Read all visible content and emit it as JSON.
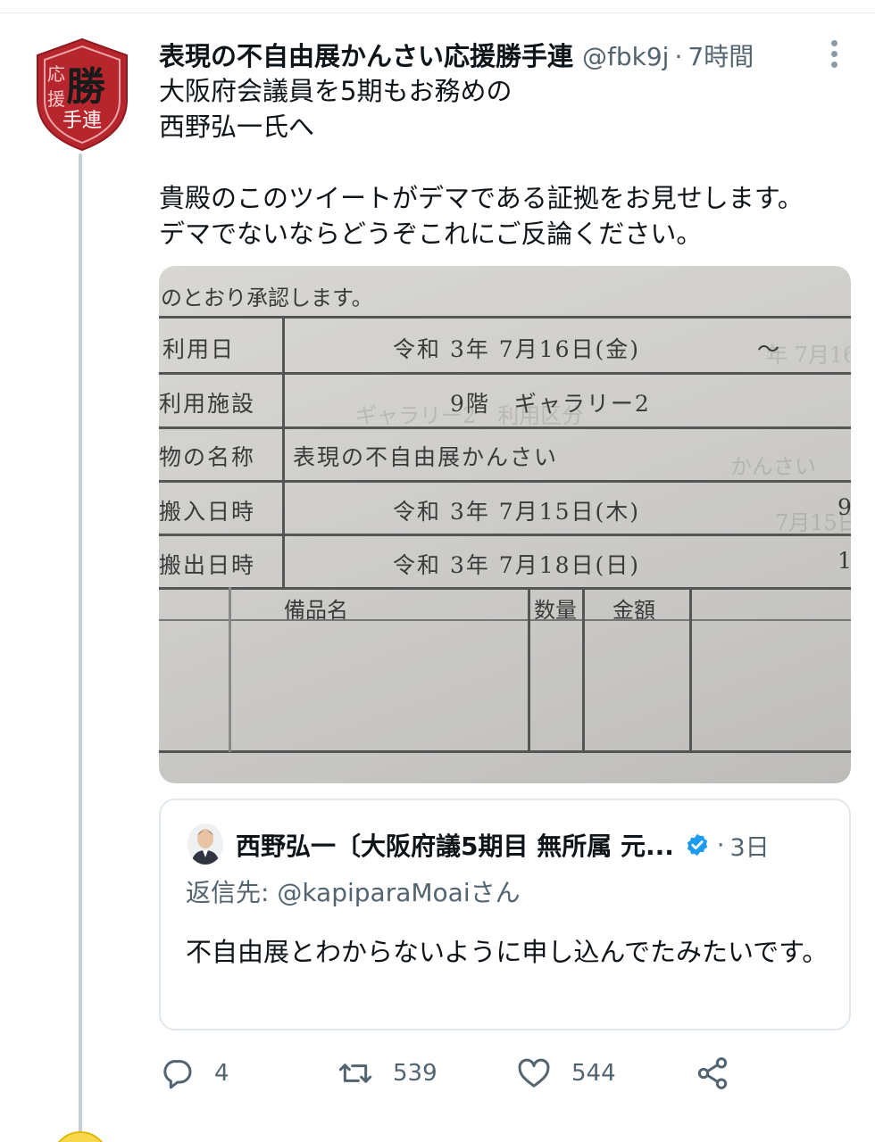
{
  "tweet": {
    "author_name": "表現の不自由展かんさい応援勝手連",
    "handle": "@fbk9j",
    "separator": "·",
    "time": "7時間",
    "avatar_text": {
      "top_left": "応",
      "mid_left": "援",
      "big": "勝",
      "bottom": "手連"
    },
    "text_lines": [
      "大阪府会議員を5期もお務めの",
      "西野弘一氏へ",
      "",
      "貴殿のこのツイートがデマである証拠をお見せします。",
      "デマでないならどうぞこれにご反論ください。"
    ]
  },
  "photo_document": {
    "header_text": "のとおり承認します。",
    "rows": [
      {
        "label": "利用日",
        "value": "令和 3年 7月16日(金)",
        "extra": "～"
      },
      {
        "label": "利用施設",
        "value": "9階　ギャラリー2",
        "extra": ""
      },
      {
        "label": "物の名称",
        "value": "表現の不自由展かんさい",
        "extra": ""
      },
      {
        "label": "搬入日時",
        "value": "令和 3年 7月15日(木)",
        "extra": "9"
      },
      {
        "label": "搬出日時",
        "value": "令和 3年 7月18日(日)",
        "extra": "1"
      }
    ],
    "table_headers": [
      "備品名",
      "数量",
      "金額"
    ]
  },
  "quote": {
    "author_name": "西野弘一〔大阪府議5期目 無所属 元...",
    "separator": "·",
    "time": "3日",
    "reply_to": "返信先: @kapiparaMoaiさん",
    "text": "不自由展とわからないように申し込んでたみたいです。",
    "verified_color": "#1d9bf0"
  },
  "actions": {
    "reply_count": "4",
    "retweet_count": "539",
    "like_count": "544"
  },
  "colors": {
    "shield_red": "#b8262d",
    "secondary_text": "#536471",
    "thread_line": "#c4cfd6"
  }
}
